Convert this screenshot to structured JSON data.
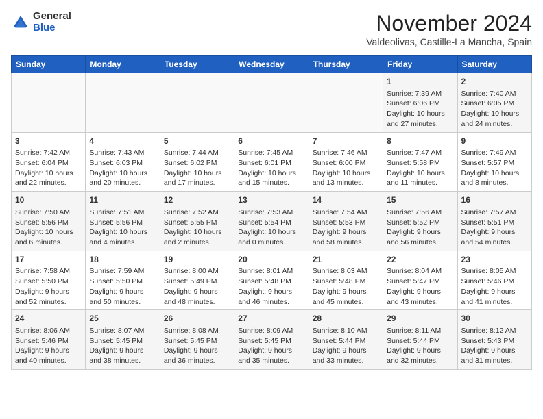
{
  "logo": {
    "general": "General",
    "blue": "Blue"
  },
  "title": "November 2024",
  "subtitle": "Valdeolivas, Castille-La Mancha, Spain",
  "days_of_week": [
    "Sunday",
    "Monday",
    "Tuesday",
    "Wednesday",
    "Thursday",
    "Friday",
    "Saturday"
  ],
  "weeks": [
    [
      {
        "day": "",
        "sunrise": "",
        "sunset": "",
        "daylight": ""
      },
      {
        "day": "",
        "sunrise": "",
        "sunset": "",
        "daylight": ""
      },
      {
        "day": "",
        "sunrise": "",
        "sunset": "",
        "daylight": ""
      },
      {
        "day": "",
        "sunrise": "",
        "sunset": "",
        "daylight": ""
      },
      {
        "day": "",
        "sunrise": "",
        "sunset": "",
        "daylight": ""
      },
      {
        "day": "1",
        "sunrise": "Sunrise: 7:39 AM",
        "sunset": "Sunset: 6:06 PM",
        "daylight": "Daylight: 10 hours and 27 minutes."
      },
      {
        "day": "2",
        "sunrise": "Sunrise: 7:40 AM",
        "sunset": "Sunset: 6:05 PM",
        "daylight": "Daylight: 10 hours and 24 minutes."
      }
    ],
    [
      {
        "day": "3",
        "sunrise": "Sunrise: 7:42 AM",
        "sunset": "Sunset: 6:04 PM",
        "daylight": "Daylight: 10 hours and 22 minutes."
      },
      {
        "day": "4",
        "sunrise": "Sunrise: 7:43 AM",
        "sunset": "Sunset: 6:03 PM",
        "daylight": "Daylight: 10 hours and 20 minutes."
      },
      {
        "day": "5",
        "sunrise": "Sunrise: 7:44 AM",
        "sunset": "Sunset: 6:02 PM",
        "daylight": "Daylight: 10 hours and 17 minutes."
      },
      {
        "day": "6",
        "sunrise": "Sunrise: 7:45 AM",
        "sunset": "Sunset: 6:01 PM",
        "daylight": "Daylight: 10 hours and 15 minutes."
      },
      {
        "day": "7",
        "sunrise": "Sunrise: 7:46 AM",
        "sunset": "Sunset: 6:00 PM",
        "daylight": "Daylight: 10 hours and 13 minutes."
      },
      {
        "day": "8",
        "sunrise": "Sunrise: 7:47 AM",
        "sunset": "Sunset: 5:58 PM",
        "daylight": "Daylight: 10 hours and 11 minutes."
      },
      {
        "day": "9",
        "sunrise": "Sunrise: 7:49 AM",
        "sunset": "Sunset: 5:57 PM",
        "daylight": "Daylight: 10 hours and 8 minutes."
      }
    ],
    [
      {
        "day": "10",
        "sunrise": "Sunrise: 7:50 AM",
        "sunset": "Sunset: 5:56 PM",
        "daylight": "Daylight: 10 hours and 6 minutes."
      },
      {
        "day": "11",
        "sunrise": "Sunrise: 7:51 AM",
        "sunset": "Sunset: 5:56 PM",
        "daylight": "Daylight: 10 hours and 4 minutes."
      },
      {
        "day": "12",
        "sunrise": "Sunrise: 7:52 AM",
        "sunset": "Sunset: 5:55 PM",
        "daylight": "Daylight: 10 hours and 2 minutes."
      },
      {
        "day": "13",
        "sunrise": "Sunrise: 7:53 AM",
        "sunset": "Sunset: 5:54 PM",
        "daylight": "Daylight: 10 hours and 0 minutes."
      },
      {
        "day": "14",
        "sunrise": "Sunrise: 7:54 AM",
        "sunset": "Sunset: 5:53 PM",
        "daylight": "Daylight: 9 hours and 58 minutes."
      },
      {
        "day": "15",
        "sunrise": "Sunrise: 7:56 AM",
        "sunset": "Sunset: 5:52 PM",
        "daylight": "Daylight: 9 hours and 56 minutes."
      },
      {
        "day": "16",
        "sunrise": "Sunrise: 7:57 AM",
        "sunset": "Sunset: 5:51 PM",
        "daylight": "Daylight: 9 hours and 54 minutes."
      }
    ],
    [
      {
        "day": "17",
        "sunrise": "Sunrise: 7:58 AM",
        "sunset": "Sunset: 5:50 PM",
        "daylight": "Daylight: 9 hours and 52 minutes."
      },
      {
        "day": "18",
        "sunrise": "Sunrise: 7:59 AM",
        "sunset": "Sunset: 5:50 PM",
        "daylight": "Daylight: 9 hours and 50 minutes."
      },
      {
        "day": "19",
        "sunrise": "Sunrise: 8:00 AM",
        "sunset": "Sunset: 5:49 PM",
        "daylight": "Daylight: 9 hours and 48 minutes."
      },
      {
        "day": "20",
        "sunrise": "Sunrise: 8:01 AM",
        "sunset": "Sunset: 5:48 PM",
        "daylight": "Daylight: 9 hours and 46 minutes."
      },
      {
        "day": "21",
        "sunrise": "Sunrise: 8:03 AM",
        "sunset": "Sunset: 5:48 PM",
        "daylight": "Daylight: 9 hours and 45 minutes."
      },
      {
        "day": "22",
        "sunrise": "Sunrise: 8:04 AM",
        "sunset": "Sunset: 5:47 PM",
        "daylight": "Daylight: 9 hours and 43 minutes."
      },
      {
        "day": "23",
        "sunrise": "Sunrise: 8:05 AM",
        "sunset": "Sunset: 5:46 PM",
        "daylight": "Daylight: 9 hours and 41 minutes."
      }
    ],
    [
      {
        "day": "24",
        "sunrise": "Sunrise: 8:06 AM",
        "sunset": "Sunset: 5:46 PM",
        "daylight": "Daylight: 9 hours and 40 minutes."
      },
      {
        "day": "25",
        "sunrise": "Sunrise: 8:07 AM",
        "sunset": "Sunset: 5:45 PM",
        "daylight": "Daylight: 9 hours and 38 minutes."
      },
      {
        "day": "26",
        "sunrise": "Sunrise: 8:08 AM",
        "sunset": "Sunset: 5:45 PM",
        "daylight": "Daylight: 9 hours and 36 minutes."
      },
      {
        "day": "27",
        "sunrise": "Sunrise: 8:09 AM",
        "sunset": "Sunset: 5:45 PM",
        "daylight": "Daylight: 9 hours and 35 minutes."
      },
      {
        "day": "28",
        "sunrise": "Sunrise: 8:10 AM",
        "sunset": "Sunset: 5:44 PM",
        "daylight": "Daylight: 9 hours and 33 minutes."
      },
      {
        "day": "29",
        "sunrise": "Sunrise: 8:11 AM",
        "sunset": "Sunset: 5:44 PM",
        "daylight": "Daylight: 9 hours and 32 minutes."
      },
      {
        "day": "30",
        "sunrise": "Sunrise: 8:12 AM",
        "sunset": "Sunset: 5:43 PM",
        "daylight": "Daylight: 9 hours and 31 minutes."
      }
    ]
  ]
}
